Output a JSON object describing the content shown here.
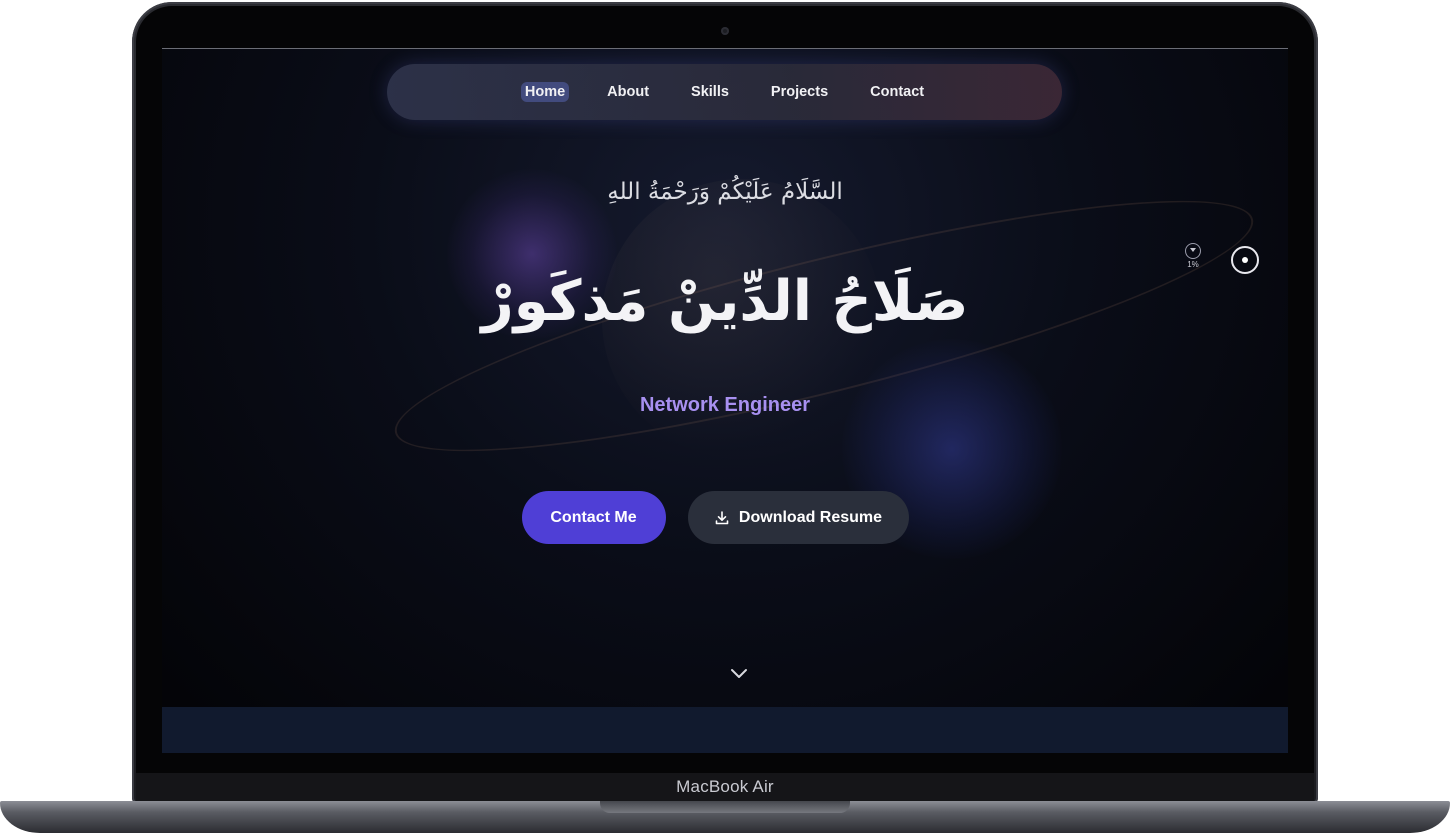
{
  "device": {
    "label": "MacBook Air"
  },
  "nav": {
    "items": [
      {
        "label": "Home",
        "active": true
      },
      {
        "label": "About",
        "active": false
      },
      {
        "label": "Skills",
        "active": false
      },
      {
        "label": "Projects",
        "active": false
      },
      {
        "label": "Contact",
        "active": false
      }
    ]
  },
  "hero": {
    "greeting": "السَّلَامُ عَلَيْكُمْ وَرَحْمَةُ اللهِ",
    "name": "صَلَاحُ الدِّينْ مَذكَورْ",
    "role": "Network Engineer",
    "contact_button": "Contact Me",
    "resume_button": "Download Resume"
  },
  "indicator": {
    "scroll_percent": "1%"
  },
  "colors": {
    "accent_purple": "#4f3fd6",
    "role_text": "#a890f0",
    "background": "#030306"
  },
  "icons": {
    "resume": "download-icon",
    "scroll": "chevron-down-icon",
    "cursor_toggle": "circle-dot-icon"
  }
}
